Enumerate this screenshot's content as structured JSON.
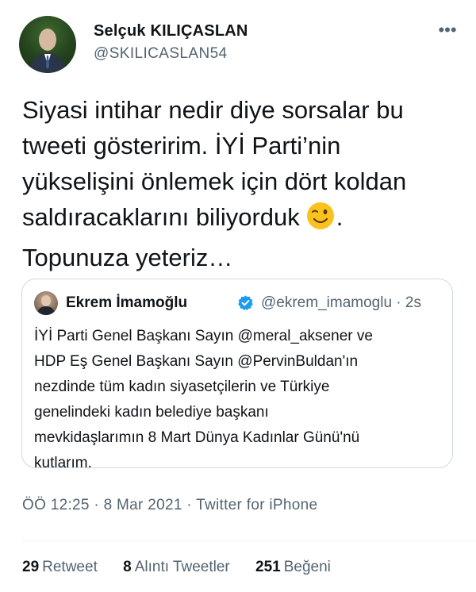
{
  "tweet": {
    "author_name": "Selçuk KILIÇASLAN",
    "author_handle": "@SKILICASLAN54",
    "more_icon": "more-horizontal-icon",
    "text_lines": [
      "Siyasi intihar nedir diye sorsalar bu",
      "tweeti gösteririm. İYİ Parti’nin",
      "yükselişini önlemek için dört koldan",
      "saldıracaklarını biliyorduk",
      "Topunuza yeteriz…"
    ],
    "emoji": "winking-face-emoji",
    "after_emoji": "."
  },
  "quoted_tweet": {
    "author_name": "Ekrem İmamoğlu",
    "verified_icon": "verified-badge-icon",
    "handle_time": "@ekrem_imamoglu · 2s",
    "text_lines": [
      "İYİ Parti Genel Başkanı Sayın @meral_aksener ve",
      "HDP Eş Genel Başkanı Sayın @PervinBuldan'ın",
      "nezdinde tüm kadın siyasetçilerin ve Türkiye",
      "genelindeki kadın belediye başkanı",
      "mevkidaşlarımın 8 Mart Dünya Kadınlar Günü'nü",
      "kutlarım."
    ]
  },
  "meta": {
    "timestamp": "ÖÖ 12:25 · 8 Mar 2021 · Twitter for iPhone"
  },
  "stats": {
    "retweets_count": "29",
    "retweets_label": "Retweet",
    "quotes_count": "8",
    "quotes_label": "Alıntı Tweetler",
    "likes_count": "251",
    "likes_label": "Beğeni"
  },
  "colors": {
    "text": "#0f1419",
    "secondary": "#536471",
    "border": "#cfd9de",
    "verified": "#1d9bf0",
    "emoji": "#f9c21e"
  }
}
